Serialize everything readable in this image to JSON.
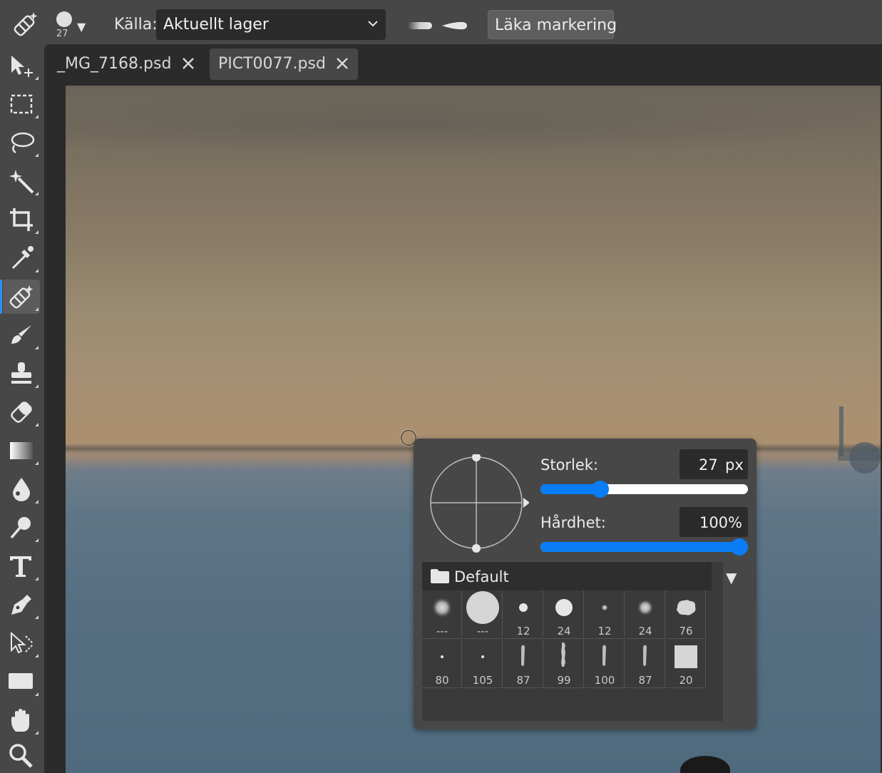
{
  "toolbar_options": {
    "brush_size": "27",
    "source_label": "Källa:",
    "source_value": "Aktuellt lager",
    "heal_selection_label": "Läka markering"
  },
  "tabs": [
    {
      "name": "_MG_7168.psd",
      "active": false
    },
    {
      "name": "PICT0077.psd",
      "active": true
    }
  ],
  "tools": [
    {
      "name": "move-tool",
      "icon": "move-icon"
    },
    {
      "name": "marquee-tool",
      "icon": "marquee-icon"
    },
    {
      "name": "lasso-tool",
      "icon": "lasso-icon"
    },
    {
      "name": "magic-wand-tool",
      "icon": "magic-wand-icon"
    },
    {
      "name": "crop-tool",
      "icon": "crop-icon"
    },
    {
      "name": "eyedropper-tool",
      "icon": "eyedropper-icon"
    },
    {
      "name": "healing-brush-tool",
      "icon": "bandage-icon",
      "active": true
    },
    {
      "name": "brush-tool",
      "icon": "brush-icon"
    },
    {
      "name": "clone-stamp-tool",
      "icon": "stamp-icon"
    },
    {
      "name": "eraser-tool",
      "icon": "eraser-icon"
    },
    {
      "name": "gradient-tool",
      "icon": "gradient-icon"
    },
    {
      "name": "blur-tool",
      "icon": "drop-icon"
    },
    {
      "name": "dodge-tool",
      "icon": "dodge-icon"
    },
    {
      "name": "type-tool",
      "icon": "text-icon"
    },
    {
      "name": "pen-tool",
      "icon": "pen-icon"
    },
    {
      "name": "path-select-tool",
      "icon": "direct-select-icon"
    },
    {
      "name": "shape-tool",
      "icon": "rectangle-icon"
    },
    {
      "name": "hand-tool",
      "icon": "hand-icon"
    },
    {
      "name": "zoom-tool",
      "icon": "zoom-icon"
    }
  ],
  "brush_panel": {
    "size_label": "Storlek:",
    "size_value": "27",
    "size_unit": "px",
    "size_fraction": 0.27,
    "hardness_label": "Hårdhet:",
    "hardness_value": "100%",
    "hardness_fraction": 1.0,
    "preset_folder": "Default",
    "presets": [
      {
        "label": "---",
        "kind": "soft"
      },
      {
        "label": "---",
        "kind": "hard-large"
      },
      {
        "label": "12",
        "kind": "hard-small"
      },
      {
        "label": "24",
        "kind": "hard-medium"
      },
      {
        "label": "12",
        "kind": "soft-small"
      },
      {
        "label": "24",
        "kind": "soft-medium"
      },
      {
        "label": "76",
        "kind": "splatter"
      },
      {
        "label": "80",
        "kind": "dot"
      },
      {
        "label": "105",
        "kind": "dot"
      },
      {
        "label": "87",
        "kind": "stroke"
      },
      {
        "label": "99",
        "kind": "stroke-rough"
      },
      {
        "label": "100",
        "kind": "stroke"
      },
      {
        "label": "87",
        "kind": "stroke"
      },
      {
        "label": "20",
        "kind": "square"
      }
    ]
  },
  "colors": {
    "accent": "#0a7cf5",
    "panel": "#474747",
    "dark": "#2b2b2b"
  }
}
